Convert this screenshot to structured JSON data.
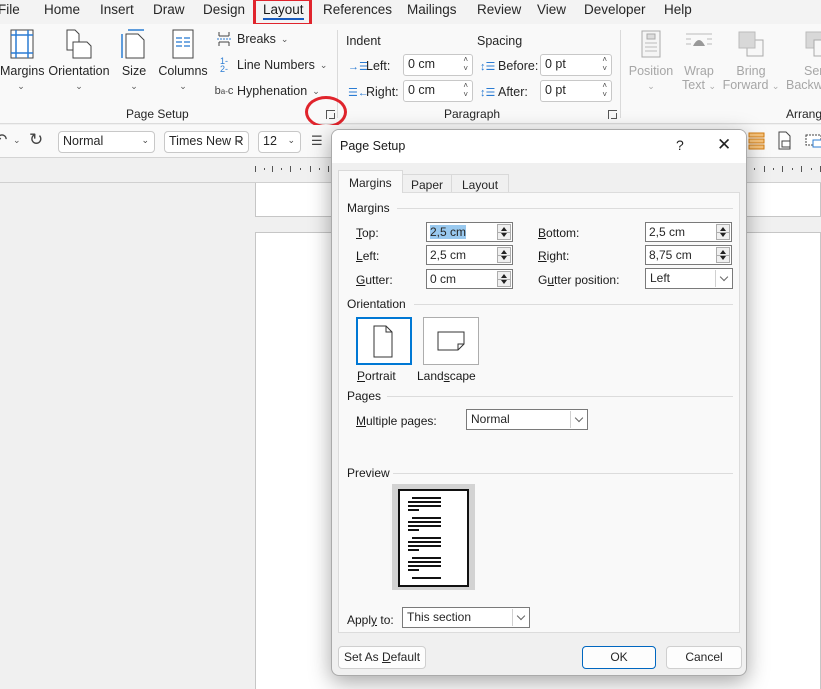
{
  "menu_tabs": [
    {
      "label": "File"
    },
    {
      "label": "Home"
    },
    {
      "label": "Insert"
    },
    {
      "label": "Draw"
    },
    {
      "label": "Design"
    },
    {
      "label": "Layout",
      "active": true
    },
    {
      "label": "References"
    },
    {
      "label": "Mailings"
    },
    {
      "label": "Review"
    },
    {
      "label": "View"
    },
    {
      "label": "Developer"
    },
    {
      "label": "Help"
    }
  ],
  "ribbon": {
    "page_setup": {
      "label": "Page Setup",
      "margins": "Margins",
      "orientation": "Orientation",
      "size": "Size",
      "columns": "Columns",
      "breaks": "Breaks",
      "line_numbers": "Line Numbers",
      "hyphenation": "Hyphenation"
    },
    "paragraph": {
      "label": "Paragraph",
      "indent_header": "Indent",
      "spacing_header": "Spacing",
      "left_label": "Left:",
      "left_value": "0 cm",
      "right_label": "Right:",
      "right_value": "0 cm",
      "before_label": "Before:",
      "before_value": "0 pt",
      "after_label": "After:",
      "after_value": "0 pt"
    },
    "arrange": {
      "label": "Arrang",
      "position": "Position",
      "wrap_text_1": "Wrap",
      "wrap_text_2": "Text",
      "bring_forward_1": "Bring",
      "bring_forward_2": "Forward",
      "send_backward_1": "Sen",
      "send_backward_2": "Backwa"
    }
  },
  "quick_toolbar": {
    "style_value": "Normal",
    "font_value": "Times New R",
    "size_value": "12"
  },
  "dialog": {
    "title": "Page Setup",
    "help": "?",
    "close": "✕",
    "tabs": [
      "Margins",
      "Paper",
      "Layout"
    ],
    "margins_section": {
      "header": "Margins",
      "top_label": [
        "T",
        "op:"
      ],
      "top_value": "2,5 cm",
      "bottom_label": [
        "B",
        "ottom:"
      ],
      "bottom_value": "2,5 cm",
      "left_label": [
        "L",
        "eft:"
      ],
      "left_value": "2,5 cm",
      "right_label": [
        "R",
        "ight:"
      ],
      "right_value": "8,75 cm",
      "gutter_label": [
        "G",
        "utter:"
      ],
      "gutter_value": "0 cm",
      "gutter_position_label": [
        "G",
        "u",
        "tter position:"
      ],
      "gutter_position_value": "Left"
    },
    "orientation_section": {
      "header": "Orientation",
      "portrait": [
        "P",
        "ortrait"
      ],
      "landscape": [
        "Land",
        "s",
        "cape"
      ],
      "selected": "Portrait"
    },
    "pages_section": {
      "header": "Pages",
      "multiple_pages_label": [
        "M",
        "ultiple pages:"
      ],
      "multiple_pages_value": "Normal"
    },
    "preview_section": {
      "header": "Preview",
      "apply_to_label": [
        "Appl",
        "y",
        " to:"
      ],
      "apply_to_value": "This section"
    },
    "buttons": {
      "set_default": [
        "Set As ",
        "D",
        "efault"
      ],
      "ok": "OK",
      "cancel": "Cancel"
    }
  },
  "colors": {
    "accent": "#185abd",
    "highlight": "#e0242c",
    "selection": "#99c9ef",
    "focus_blue": "#0078d4"
  }
}
